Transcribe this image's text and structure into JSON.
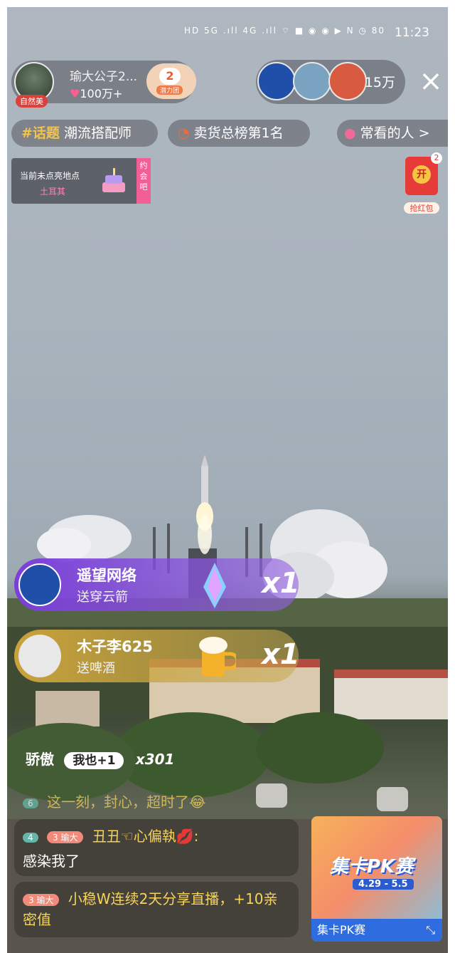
{
  "status_bar": {
    "icons_text": "HD 5G .ıll 4G .ıll ⌔ ■ ◉ ◉ ▶ N ◷ 80",
    "time": "11:23"
  },
  "host": {
    "tag": "自然美",
    "name": "瑜大公子2...",
    "likes": "100万+",
    "fan_level": "2",
    "fan_label": "潜力团"
  },
  "viewers": {
    "count": "15万"
  },
  "chips": [
    {
      "hash": "#话题",
      "label": "潮流搭配师"
    },
    {
      "label": "卖货总榜第1名"
    },
    {
      "label": "常看的人 >"
    }
  ],
  "date_card": {
    "line1": "当前未点亮地点",
    "line2": "土耳其",
    "side": "约会吧"
  },
  "red_packet": {
    "open": "开",
    "label": "抢红包",
    "count": "2"
  },
  "gifts": [
    {
      "name": "遥望网络",
      "desc": "送穿云箭",
      "multiplier": "x1"
    },
    {
      "name": "木子李625",
      "desc": "送啤酒",
      "multiplier": "x1"
    }
  ],
  "combo": {
    "user": "骄傲",
    "button": "我也+1",
    "count": "x301"
  },
  "chat": [
    {
      "level": "6",
      "text": "这一刻，封心，超时了😂"
    },
    {
      "level": "4",
      "fan": "3 瑜大",
      "user": "丑丑☜心偏執💋",
      "text": "感染我了"
    },
    {
      "fan": "3 瑜大",
      "text": "小稳W连续2天分享直播，+10亲密值"
    }
  ],
  "pk_card": {
    "title": "集卡PK赛",
    "dates": "4.29 - 5.5",
    "bar": "集卡PK赛"
  },
  "colors": {
    "accent_gold": "#f5d35c",
    "gift1_purple": "#7b3fd9",
    "gift2_gold": "#c9a23a",
    "pk_blue": "#2f6ce0"
  }
}
